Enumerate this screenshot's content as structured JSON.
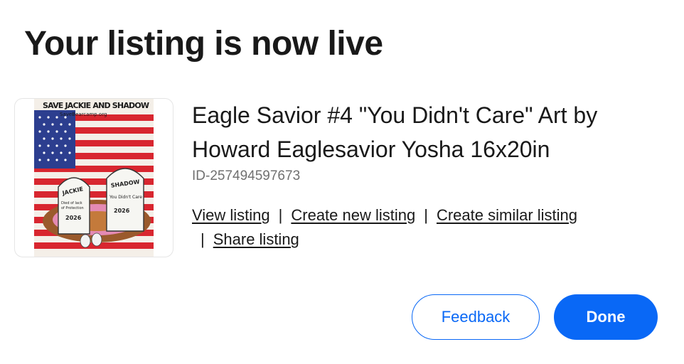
{
  "header": {
    "title": "Your listing is now live"
  },
  "listing": {
    "title": "Eagle Savior #4 \"You Didn't Care\" Art by Howard Eaglesavior Yosha 16x20in",
    "id": "ID-257494597673",
    "thumbnail": {
      "banner_text": "SAVE JACKIE AND SHADOW",
      "url_text": "SaveBearcamp.org",
      "left_stone": [
        "JACKIE",
        "Died of lack",
        "of Protection",
        "2026"
      ],
      "right_stone": [
        "SHADOW",
        "You Didn't Care",
        "2026"
      ]
    },
    "links": {
      "view": "View listing",
      "create_new": "Create new listing",
      "create_similar": "Create similar listing",
      "share": "Share listing",
      "separator": "|"
    }
  },
  "actions": {
    "feedback_label": "Feedback",
    "done_label": "Done"
  },
  "colors": {
    "primary": "#0968f6",
    "text": "#191919",
    "muted": "#707070"
  }
}
